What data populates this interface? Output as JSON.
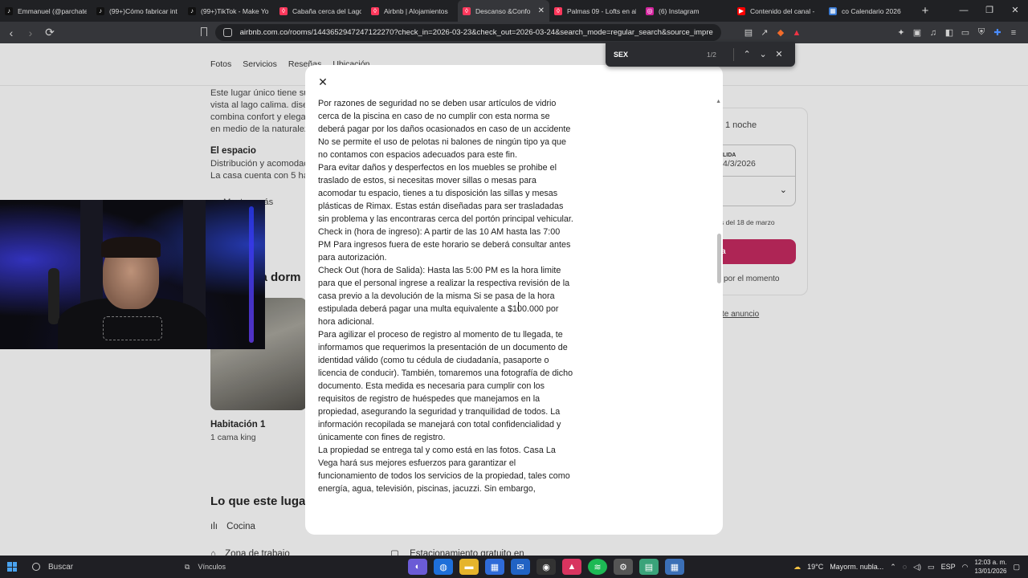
{
  "tabs": [
    {
      "label": "Emmanuel (@parchate",
      "icon": "tiktok-icon",
      "color": "#111111"
    },
    {
      "label": "(99+)Cómo fabricar int",
      "icon": "tiktok-icon",
      "color": "#111111"
    },
    {
      "label": "(99+)TikTok - Make Yo",
      "icon": "tiktok-icon",
      "color": "#111111"
    },
    {
      "label": "Cabaña cerca del Lago",
      "icon": "airbnb-icon",
      "color": "#ff385c"
    },
    {
      "label": "Airbnb | Alojamientos",
      "icon": "airbnb-icon",
      "color": "#ff385c"
    },
    {
      "label": "Descanso &Confo",
      "icon": "airbnb-icon",
      "color": "#ff385c",
      "active": true
    },
    {
      "label": "Palmas 09 - Lofts en al",
      "icon": "airbnb-icon",
      "color": "#ff385c"
    },
    {
      "label": "(6) Instagram",
      "icon": "instagram-icon",
      "color": "#d6249f"
    },
    {
      "label": "Contenido del canal -",
      "icon": "youtube-icon",
      "color": "#ff0000"
    },
    {
      "label": "co Calendario 2026",
      "icon": "calendar-icon",
      "color": "#3a7bd5"
    }
  ],
  "url": "airbnb.com.co/rooms/1443652947247122270?check_in=2026-03-23&check_out=2026-03-24&search_mode=regular_search&source_impressio...",
  "find": {
    "query": "SEX",
    "count": "1/2"
  },
  "page": {
    "nav": [
      "Fotos",
      "Servicios",
      "Reseñas",
      "Ubicación"
    ],
    "desc_lines": [
      "Este lugar único tiene su",
      "vista al lago calima. dise",
      "combina confort y elega",
      "en medio de la naturalez"
    ],
    "space_title": "El espacio",
    "space_lines": [
      "Distribución y acomodac",
      "La casa cuenta con 5 hab"
    ],
    "show_more": "Mostrar más",
    "sleep_title": "s a dorm",
    "room_title": "Habitación 1",
    "room_sub": "1 cama king",
    "offers_title": "Lo que este lugar o",
    "amenity_1": "Cocina",
    "amenity_2": "Zona de trabajo",
    "amenity_3": "Estacionamiento gratuito en",
    "booking": {
      "price_suffix": "1 noche",
      "checkout_label": "LIDA",
      "checkout_value": "4/3/2026",
      "cancel_note": "s del 18 de marzo",
      "reserve": "a",
      "no_charge": "por el momento",
      "report": "te anuncio"
    }
  },
  "modal": {
    "paragraphs": [
      " Por razones de seguridad no se deben usar artículos de vidrio cerca de la piscina en caso de no cumplir con esta norma se deberá pagar por los daños ocasionados en caso de un accidente",
      " No se permite el uso de pelotas ni balones de ningún tipo ya que no contamos con espacios adecuados para este fin.",
      " Para evitar daños y desperfectos en los muebles se prohibe el traslado de estos, si necesitas mover sillas o mesas para acomodar tu espacio, tienes a tu disposición las sillas y mesas plásticas de Rimax. Estas están diseñadas para ser trasladadas sin problema y las encontraras cerca del portón principal vehicular.",
      " Check in (hora de ingreso): A partir de las 10 AM hasta las 7:00 PM Para ingresos fuera de este horario se deberá consultar antes para autorización.",
      " Check Out (hora de Salida): Hasta las 5:00 PM es la hora limite para que el personal ingrese a realizar la respectiva revisión de la casa previo a la devolución de la misma Si se pasa de la hora estipulada deberá pagar una multa equivalente a $100.000 por hora adicional.",
      " Para agilizar el proceso de registro al momento de tu llegada, te informamos que requerimos la presentación de un documento de identidad válido (como tu cédula de ciudadanía, pasaporte o licencia de conducir). También, tomaremos una fotografía de dicho documento. Esta medida es necesaria para cumplir con los requisitos de registro de huéspedes que manejamos en la propiedad, asegurando la seguridad y tranquilidad de todos. La información recopilada se manejará con total confidencialidad y únicamente con fines de registro.",
      " La propiedad se entrega tal y como está en las fotos. Casa La Vega hará sus mejores esfuerzos para garantizar el funcionamiento de todos los servicios de la propiedad, tales como energía, agua, televisión, piscinas, jacuzzi. Sin embargo,"
    ]
  },
  "taskbar": {
    "search": "Buscar",
    "widgets": "Vínculos",
    "weather": "19°C",
    "weather_desc": "Mayorm. nubla...",
    "lang": "ESP",
    "time": "12:03 a. m.",
    "date": "13/01/2026"
  },
  "colors": {
    "accent": "#ff385c",
    "reserve": "#b8285a",
    "chrome_dark": "#202124"
  }
}
